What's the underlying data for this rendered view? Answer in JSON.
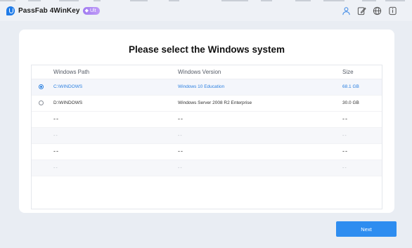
{
  "app": {
    "name": "PassFab 4WinKey",
    "badge": "Ult",
    "icons": [
      "user-icon",
      "feedback-icon",
      "language-icon",
      "info-icon"
    ]
  },
  "page": {
    "title": "Please select the Windows system"
  },
  "table": {
    "columns": [
      "Windows Path",
      "Windows Version",
      "Size"
    ],
    "rows": [
      {
        "path": "C:\\WINDOWS",
        "version": "Windows 10 Education",
        "size": "68.1 GB",
        "selected": true
      },
      {
        "path": "D:\\WINDOWS",
        "version": "Windows Server 2008 R2 Enterprise",
        "size": "30.0 GB",
        "selected": false
      }
    ],
    "empty": [
      "--",
      "--",
      "--",
      "--",
      "--",
      "--",
      "--",
      "--",
      "--",
      "--",
      "--",
      "--"
    ]
  },
  "footer": {
    "next_label": "Next"
  },
  "colors": {
    "accent": "#2e8df0",
    "selected_text": "#2a7fe0",
    "background": "#e9edf3"
  }
}
